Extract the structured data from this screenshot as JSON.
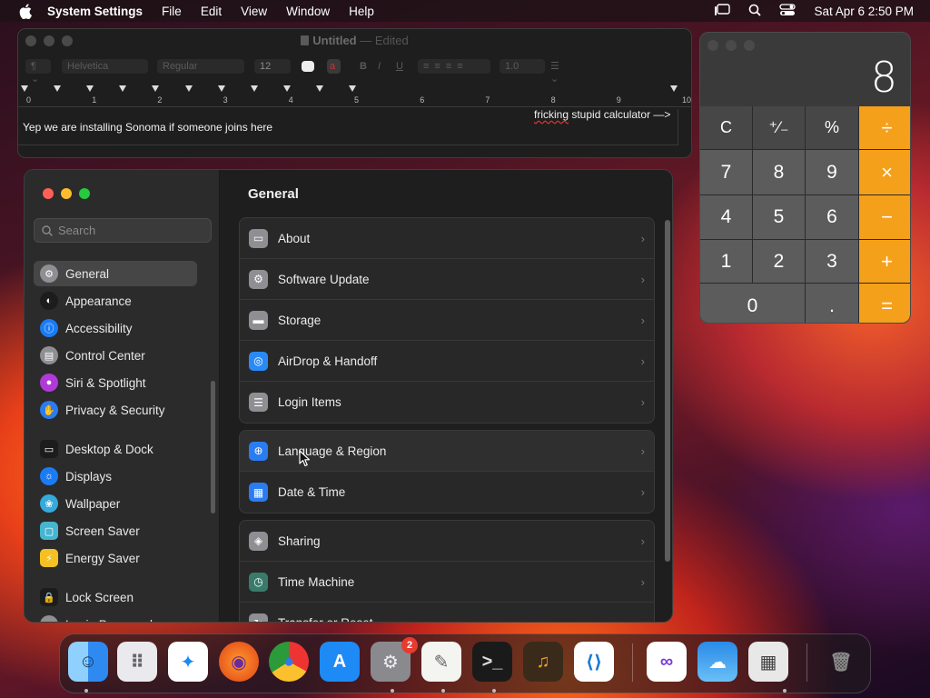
{
  "menubar": {
    "app_name": "System Settings",
    "items": [
      "File",
      "Edit",
      "View",
      "Window",
      "Help"
    ],
    "datetime": "Sat Apr 6  2:50 PM"
  },
  "textedit": {
    "title": "Untitled",
    "title_sep": "—",
    "title_status": "Edited",
    "paragraph_label": "¶",
    "font_family": "Helvetica",
    "font_style": "Regular",
    "font_size": "12",
    "line_spacing": "1.0",
    "ruler_numbers": [
      "0",
      "1",
      "2",
      "3",
      "4",
      "5",
      "6",
      "7",
      "8",
      "9",
      "10"
    ],
    "body_text": "Yep we are installing Sonoma if someone joins here",
    "note_prefix": "",
    "note_word": "fricking",
    "note_rest": " stupid calculator —>"
  },
  "calculator": {
    "display": "8",
    "keys": {
      "clear": "C",
      "sign": "⁺∕₋",
      "percent": "%",
      "divide": "÷",
      "seven": "7",
      "eight": "8",
      "nine": "9",
      "multiply": "×",
      "four": "4",
      "five": "5",
      "six": "6",
      "minus": "−",
      "one": "1",
      "two": "2",
      "three": "3",
      "plus": "+",
      "zero": "0",
      "decimal": ".",
      "equals": "="
    },
    "accent_color": "#f5a01a"
  },
  "settings": {
    "search_placeholder": "Search",
    "title": "General",
    "sidebar": [
      {
        "label": "General",
        "icon": "gear-icon",
        "color": "#8e8e93"
      },
      {
        "label": "Appearance",
        "icon": "appearance-icon",
        "color": "#1c1c1e"
      },
      {
        "label": "Accessibility",
        "icon": "accessibility-icon",
        "color": "#1a7cf5"
      },
      {
        "label": "Control Center",
        "icon": "control-center-icon",
        "color": "#8e8e93"
      },
      {
        "label": "Siri & Spotlight",
        "icon": "siri-icon",
        "color": "#b03ad8"
      },
      {
        "label": "Privacy & Security",
        "icon": "hand-icon",
        "color": "#2a7cf0"
      },
      {
        "label": "Desktop & Dock",
        "icon": "dock-icon",
        "color": "#1c1c1e"
      },
      {
        "label": "Displays",
        "icon": "displays-icon",
        "color": "#1a7cf5"
      },
      {
        "label": "Wallpaper",
        "icon": "wallpaper-icon",
        "color": "#35aadc"
      },
      {
        "label": "Screen Saver",
        "icon": "screen-saver-icon",
        "color": "#46b6d0"
      },
      {
        "label": "Energy Saver",
        "icon": "energy-saver-icon",
        "color": "#f5c023"
      },
      {
        "label": "Lock Screen",
        "icon": "lock-icon",
        "color": "#1c1c1e"
      },
      {
        "label": "Login Password",
        "icon": "login-password-icon",
        "color": "#8e8e93"
      }
    ],
    "groups": [
      [
        {
          "label": "About",
          "icon": "about-icon"
        },
        {
          "label": "Software Update",
          "icon": "software-update-icon"
        },
        {
          "label": "Storage",
          "icon": "storage-icon"
        },
        {
          "label": "AirDrop & Handoff",
          "icon": "airdrop-icon"
        },
        {
          "label": "Login Items",
          "icon": "login-items-icon"
        }
      ],
      [
        {
          "label": "Language & Region",
          "icon": "globe-icon"
        },
        {
          "label": "Date & Time",
          "icon": "calendar-clock-icon"
        }
      ],
      [
        {
          "label": "Sharing",
          "icon": "sharing-icon"
        },
        {
          "label": "Time Machine",
          "icon": "time-machine-icon"
        },
        {
          "label": "Transfer or Reset",
          "icon": "transfer-reset-icon"
        }
      ]
    ]
  },
  "dock": {
    "apps": [
      "Finder",
      "Launchpad",
      "Safari",
      "Firefox",
      "Chrome",
      "App Store",
      "System Settings",
      "TextEdit",
      "Terminal",
      "GarageBand",
      "Visual Studio Code",
      "Visual Studio",
      "Weather",
      "Calculator",
      "Trash"
    ],
    "settings_badge": "2"
  }
}
